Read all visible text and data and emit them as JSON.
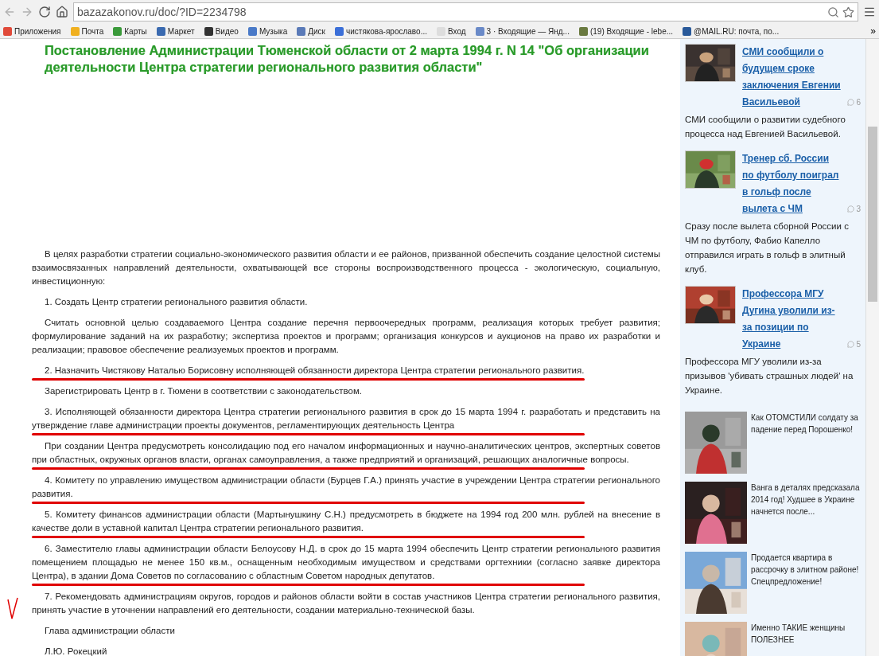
{
  "browser": {
    "url": "bazazakonov.ru/doc/?ID=2234798",
    "bookmarks": [
      {
        "label": "Приложения",
        "color": "#e04a3a"
      },
      {
        "label": "Почта",
        "color": "#f0b020"
      },
      {
        "label": "Карты",
        "color": "#3a9a3a"
      },
      {
        "label": "Маркет",
        "color": "#3a6ab0"
      },
      {
        "label": "Видео",
        "color": "#333333"
      },
      {
        "label": "Музыка",
        "color": "#4a7ac8"
      },
      {
        "label": "Диск",
        "color": "#5a7ab8"
      },
      {
        "label": "чистякова-ярославо...",
        "color": "#3b6fd8"
      },
      {
        "label": "Вход",
        "color": "#dddddd"
      },
      {
        "label": "3 · Входящие — Янд...",
        "color": "#6a8ac8"
      },
      {
        "label": "(19) Входящие - lebe...",
        "color": "#6a7a40"
      },
      {
        "label": "@MAIL.RU: почта, по...",
        "color": "#2a5a9a"
      }
    ],
    "overflow": "»"
  },
  "document": {
    "title": "Постановление Администрации Тюменской области от 2 марта 1994 г. N 14 \"Об организации деятельности Центра стратегии регионального развития области\"",
    "paragraphs": [
      {
        "text": "В целях разработки стратегии социально-экономического развития области и ее районов, призванной обеспечить создание целостной системы взаимосвязанных направлений деятельности, охватывающей все стороны воспроизводственного процесса - экологическую, социальную, инвестиционную:",
        "marked": false
      },
      {
        "text": "1. Создать Центр стратегии регионального развития области.",
        "marked": false
      },
      {
        "text": "Считать основной целью создаваемого Центра создание перечня первоочередных программ, реализация которых требует развития; формулирование заданий на их разработку; экспертиза проектов и программ; организация конкурсов и аукционов на право их разработки и реализации; правовое обеспечение реализуемых проектов и программ.",
        "marked": false
      },
      {
        "text": "2. Назначить Чистякову Наталью Борисовну исполняющей обязанности директора Центра стратегии регионального развития.",
        "marked": true
      },
      {
        "text": "Зарегистрировать Центр в г. Тюмени в соответствии с законодательством.",
        "marked": false
      },
      {
        "text": "3. Исполняющей обязанности директора Центра стратегии регионального развития в срок до 15 марта 1994 г. разработать и представить на утверждение главе администрации проекты документов, регламентирующих деятельность Центра",
        "marked": true
      },
      {
        "text": "При создании Центра предусмотреть консолидацию под его началом информационных и научно-аналитических центров, экспертных советов при областных, окружных органов власти, органах самоуправления, а также предприятий и организаций, решающих аналогичные вопросы.",
        "marked": true
      },
      {
        "text": "4. Комитету по управлению имуществом администрации области (Бурцев Г.А.) принять участие в учреждении Центра стратегии регионального развития.",
        "marked": true
      },
      {
        "text": "5. Комитету финансов администрации области (Мартынушкину С.Н.) предусмотреть в бюджете на 1994 год 200 млн. рублей на внесение в качестве доли в уставной капитал Центра стратегии регионального развития.",
        "marked": true
      },
      {
        "text": "6. Заместителю главы администрации области Белоусову Н.Д. в срок до 15 марта 1994 обеспечить Центр стратегии регионального развития помещением площадью не менее 150 кв.м., оснащенным необходимым имуществом и средствами оргтехники (согласно заявке директора Центра), в здании Дома Советов по согласованию с областным Советом народных депутатов.",
        "marked": true
      },
      {
        "text": "7. Рекомендовать администрациям округов, городов и районов области войти в состав участников Центра стратегии регионального развития, принять участие в уточнении направлений его деятельности, создании материально-технической базы.",
        "marked": false
      },
      {
        "text": "Глава администрации области",
        "marked": false
      },
      {
        "text": "Л.Ю. Рокецкий",
        "marked": false
      }
    ]
  },
  "sidebar": {
    "news": [
      {
        "title": "СМИ сообщили о будущем сроке заключения Евгении Васильевой",
        "comments": "6",
        "summary": "СМИ сообщили о развитии судебного процесса над Евгенией Васильевой."
      },
      {
        "title": "Тренер сб. России по футболу поиграл в гольф после вылета с ЧМ",
        "comments": "3",
        "summary": "Сразу после вылета сборной России с ЧМ по футболу, Фабио Капелло отправился играть в гольф в элитный клуб."
      },
      {
        "title": "Профессора МГУ Дугина уволили из-за позиции по Украине",
        "comments": "5",
        "summary": "Профессора МГУ уволили из-за призывов 'убивать страшных людей' на Украине."
      }
    ],
    "ads": [
      {
        "text": "Как ОТОМСТИЛИ солдату за падение перед Порошенко!"
      },
      {
        "text": "Ванга в деталях предсказала 2014 год! Худшее в Украине начнется после..."
      },
      {
        "text": "Продается квартира в рассрочку в элитном районе! Спецпредложение!"
      },
      {
        "text": "Именно ТАКИЕ женщины ПОЛЕЗНЕЕ"
      }
    ]
  }
}
